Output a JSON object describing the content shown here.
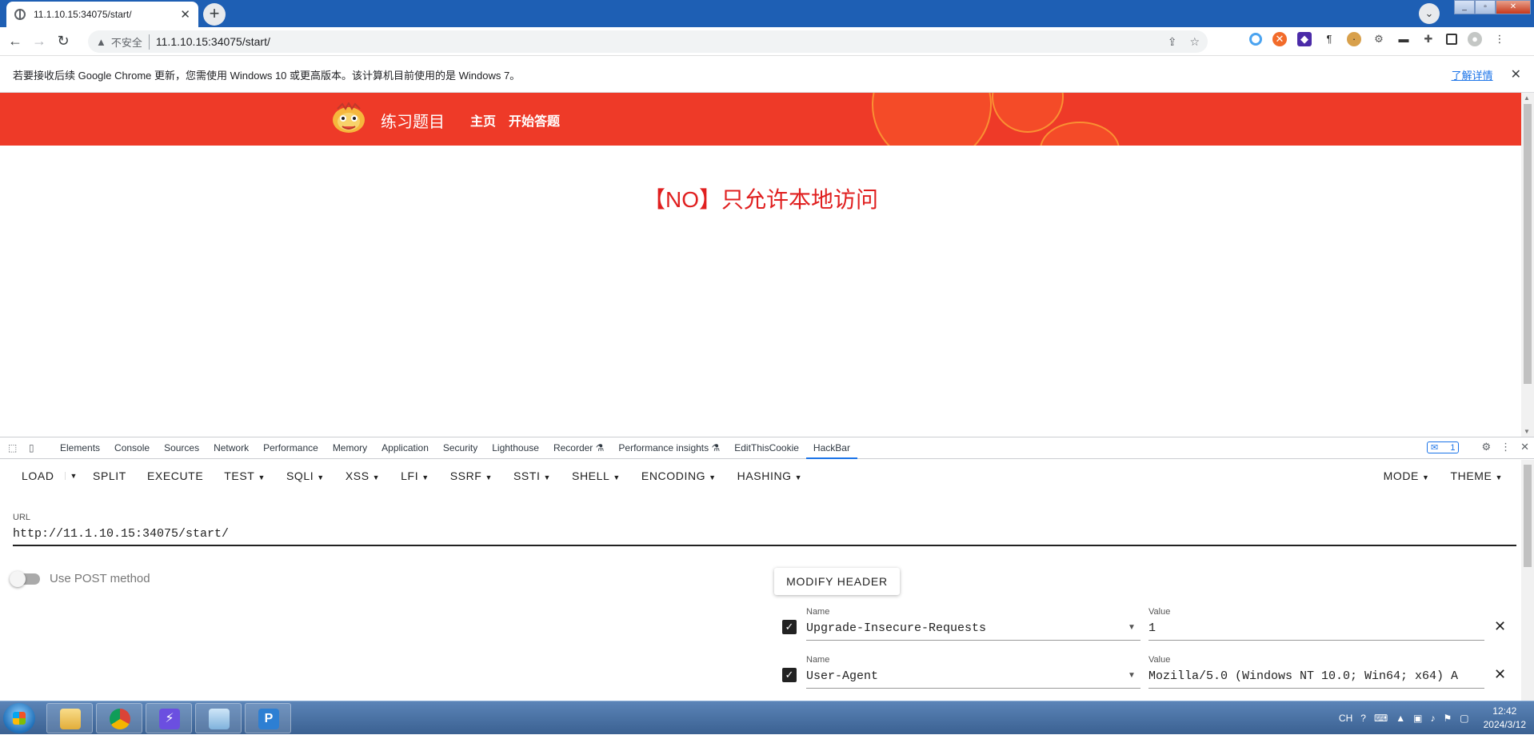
{
  "browser": {
    "tab": {
      "title": "11.1.10.15:34075/start/"
    },
    "new_tab_symbol": "+",
    "address": {
      "security_label": "不安全",
      "url": "11.1.10.15:34075/start/"
    },
    "infobar": {
      "message": "若要接收后续 Google Chrome 更新，您需使用 Windows 10 或更高版本。该计算机目前使用的是 Windows 7。",
      "learn_more": "了解详情"
    }
  },
  "page": {
    "site_title": "练习题目",
    "nav": {
      "home": "主页",
      "start": "开始答题"
    },
    "result_message": "【NO】只允许本地访问",
    "colors": {
      "banner": "#ee3a28",
      "result_text": "#e01f1f"
    }
  },
  "devtools": {
    "tabs": [
      "Elements",
      "Console",
      "Sources",
      "Network",
      "Performance",
      "Memory",
      "Application",
      "Security",
      "Lighthouse",
      "Recorder ⚗",
      "Performance insights ⚗",
      "EditThisCookie",
      "HackBar"
    ],
    "active_tab": "HackBar",
    "issues_badge": "1"
  },
  "hackbar": {
    "menu": {
      "load": "LOAD",
      "split": "SPLIT",
      "execute": "EXECUTE",
      "test": "TEST",
      "sqli": "SQLI",
      "xss": "XSS",
      "lfi": "LFI",
      "ssrf": "SSRF",
      "ssti": "SSTI",
      "shell": "SHELL",
      "encoding": "ENCODING",
      "hashing": "HASHING",
      "mode": "MODE",
      "theme": "THEME"
    },
    "url_label": "URL",
    "url_value": "http://11.1.10.15:34075/start/",
    "post_label": "Use POST method",
    "modify_header": "MODIFY HEADER",
    "headers": [
      {
        "name_label": "Name",
        "name": "Upgrade-Insecure-Requests",
        "value_label": "Value",
        "value": "1",
        "enabled": true
      },
      {
        "name_label": "Name",
        "name": "User-Agent",
        "value_label": "Value",
        "value": "Mozilla/5.0 (Windows NT 10.0; Win64; x64) A",
        "enabled": true
      }
    ]
  },
  "taskbar": {
    "language": "CH",
    "time": "12:42",
    "date": "2024/3/12"
  }
}
